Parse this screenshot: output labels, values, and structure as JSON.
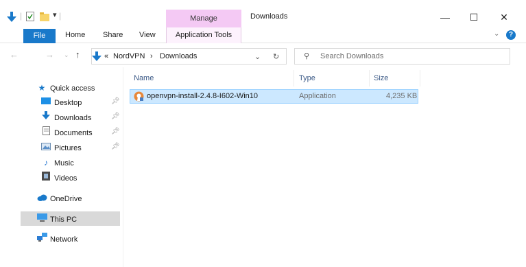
{
  "window": {
    "title": "Downloads",
    "manage_label": "Manage",
    "minimize_glyph": "—",
    "maximize_glyph": "☐",
    "close_glyph": "✕"
  },
  "ribbon": {
    "tabs": {
      "file": "File",
      "home": "Home",
      "share": "Share",
      "view": "View",
      "application_tools": "Application Tools"
    },
    "help_glyph": "?",
    "expand_glyph": "⌄"
  },
  "address": {
    "overflow": "«",
    "segment_1": "NordVPN",
    "separator": "›",
    "segment_2": "Downloads",
    "dropdown_glyph": "⌄",
    "refresh_glyph": "↻"
  },
  "search": {
    "placeholder": "Search Downloads"
  },
  "nav": {
    "quick_access": "Quick access",
    "desktop": "Desktop",
    "downloads": "Downloads",
    "documents": "Documents",
    "pictures": "Pictures",
    "music": "Music",
    "videos": "Videos",
    "onedrive": "OneDrive",
    "this_pc": "This PC",
    "network": "Network"
  },
  "columns": {
    "name": "Name",
    "type": "Type",
    "size": "Size"
  },
  "files": [
    {
      "name": "openvpn-install-2.4.8-I602-Win10",
      "type": "Application",
      "size": "4,235 KB"
    }
  ],
  "colors": {
    "accent": "#1979ca",
    "selection": "#cce8ff",
    "manage_tab": "#f4c9f4"
  }
}
